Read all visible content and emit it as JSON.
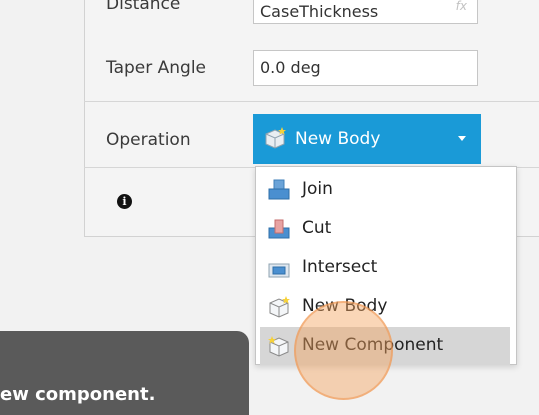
{
  "form": {
    "distance_label": "Distance",
    "distance_value": "CaseThickness",
    "distance_fx": "fx",
    "taper_label": "Taper Angle",
    "taper_value": "0.0 deg",
    "operation_label": "Operation",
    "operation_selected": "New Body"
  },
  "menu": {
    "items": [
      {
        "label": "Join",
        "icon": "join-icon"
      },
      {
        "label": "Cut",
        "icon": "cut-icon"
      },
      {
        "label": "Intersect",
        "icon": "intersect-icon"
      },
      {
        "label": "New Body",
        "icon": "new-body-icon"
      },
      {
        "label": "New Component",
        "icon": "new-component-icon"
      }
    ],
    "highlighted_index": 4
  },
  "tooltip": {
    "text": "ew component."
  },
  "colors": {
    "accent": "#1a9ad7",
    "cursor": "#f4a460"
  }
}
